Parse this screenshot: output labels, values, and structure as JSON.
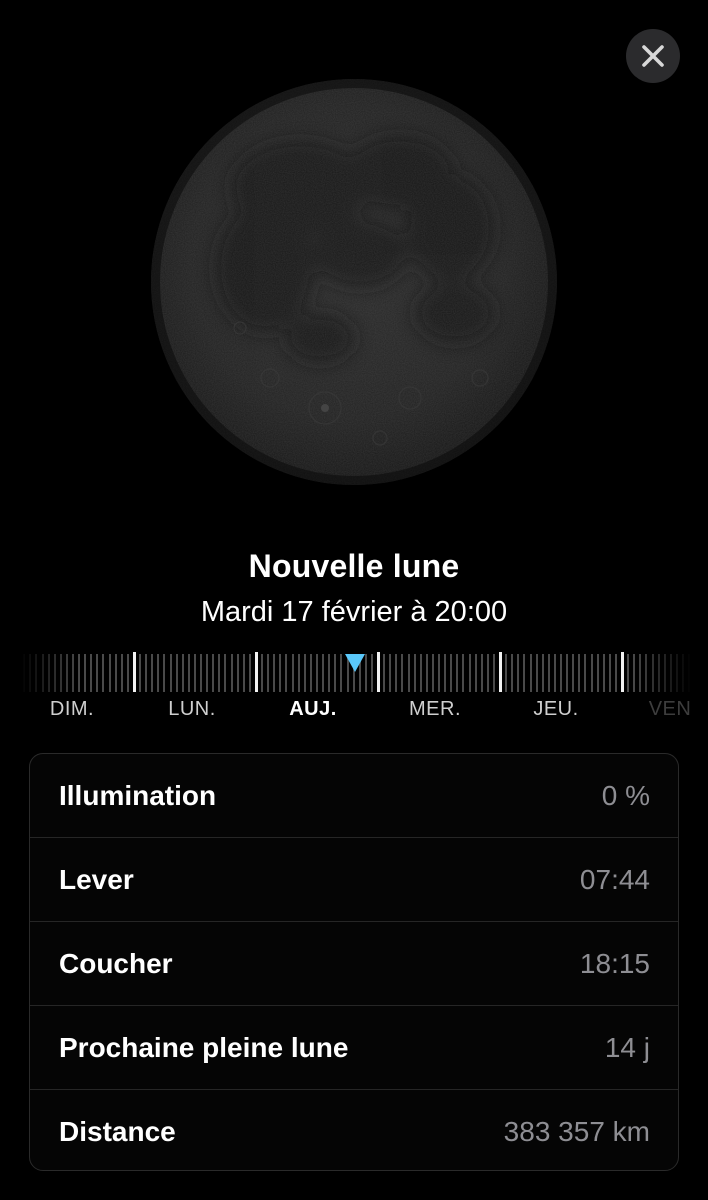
{
  "close_button": {
    "icon": "close-icon"
  },
  "moon": {
    "phase_fraction_illuminated": 0
  },
  "phase": {
    "title": "Nouvelle lune",
    "datetime": "Mardi 17 février à 20:00"
  },
  "timeline": {
    "days": [
      {
        "label": "DIM.",
        "today": false
      },
      {
        "label": "LUN.",
        "today": false
      },
      {
        "label": "AUJ.",
        "today": true
      },
      {
        "label": "MER.",
        "today": false
      },
      {
        "label": "JEU.",
        "today": false
      },
      {
        "label": "VEN",
        "today": false,
        "cut": true
      }
    ],
    "indicator_color": "#5ac8fa"
  },
  "details": [
    {
      "label": "Illumination",
      "value": "0 %"
    },
    {
      "label": "Lever",
      "value": "07:44"
    },
    {
      "label": "Coucher",
      "value": "18:15"
    },
    {
      "label": "Prochaine pleine lune",
      "value": "14 j"
    },
    {
      "label": "Distance",
      "value": "383 357 km"
    }
  ]
}
